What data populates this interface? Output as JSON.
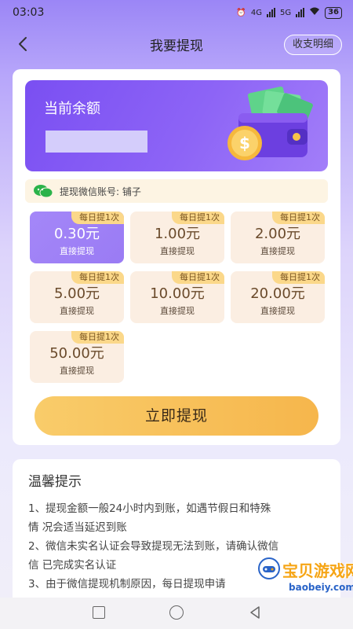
{
  "status_bar": {
    "time": "03:03",
    "network_label_1": "4G",
    "network_label_2": "5G",
    "battery": "36"
  },
  "nav": {
    "title": "我要提现",
    "right_button": "收支明细"
  },
  "balance": {
    "label": "当前余额"
  },
  "account": {
    "text": "提现微信账号: 铺子"
  },
  "amount_options": [
    {
      "tag": "每日提1次",
      "value": "0.30元",
      "sub": "直接提现",
      "selected": true
    },
    {
      "tag": "每日提1次",
      "value": "1.00元",
      "sub": "直接提现"
    },
    {
      "tag": "每日提1次",
      "value": "2.00元",
      "sub": "直接提现"
    },
    {
      "tag": "每日提1次",
      "value": "5.00元",
      "sub": "直接提现"
    },
    {
      "tag": "每日提1次",
      "value": "10.00元",
      "sub": "直接提现"
    },
    {
      "tag": "每日提1次",
      "value": "20.00元",
      "sub": "直接提现"
    },
    {
      "tag": "每日提1次",
      "value": "50.00元",
      "sub": "直接提现"
    }
  ],
  "withdraw_button": "立即提现",
  "tips": {
    "title": "温馨提示",
    "lines": [
      "1、提现金额一般24小时内到账，如遇节假日和特殊",
      "情 况会适当延迟到账",
      "2、微信未实名认证会导致提现无法到账，请确认微信",
      "信 已完成实名认证",
      "3、由于微信提现机制原因，每日提现申请"
    ]
  },
  "watermark": {
    "text": "宝贝游戏网",
    "url": "baobeiy.com"
  },
  "colors": {
    "accent_purple": "#8d64f6",
    "button_gold": "#f6b64c",
    "tag_yellow": "#fbd88a"
  }
}
